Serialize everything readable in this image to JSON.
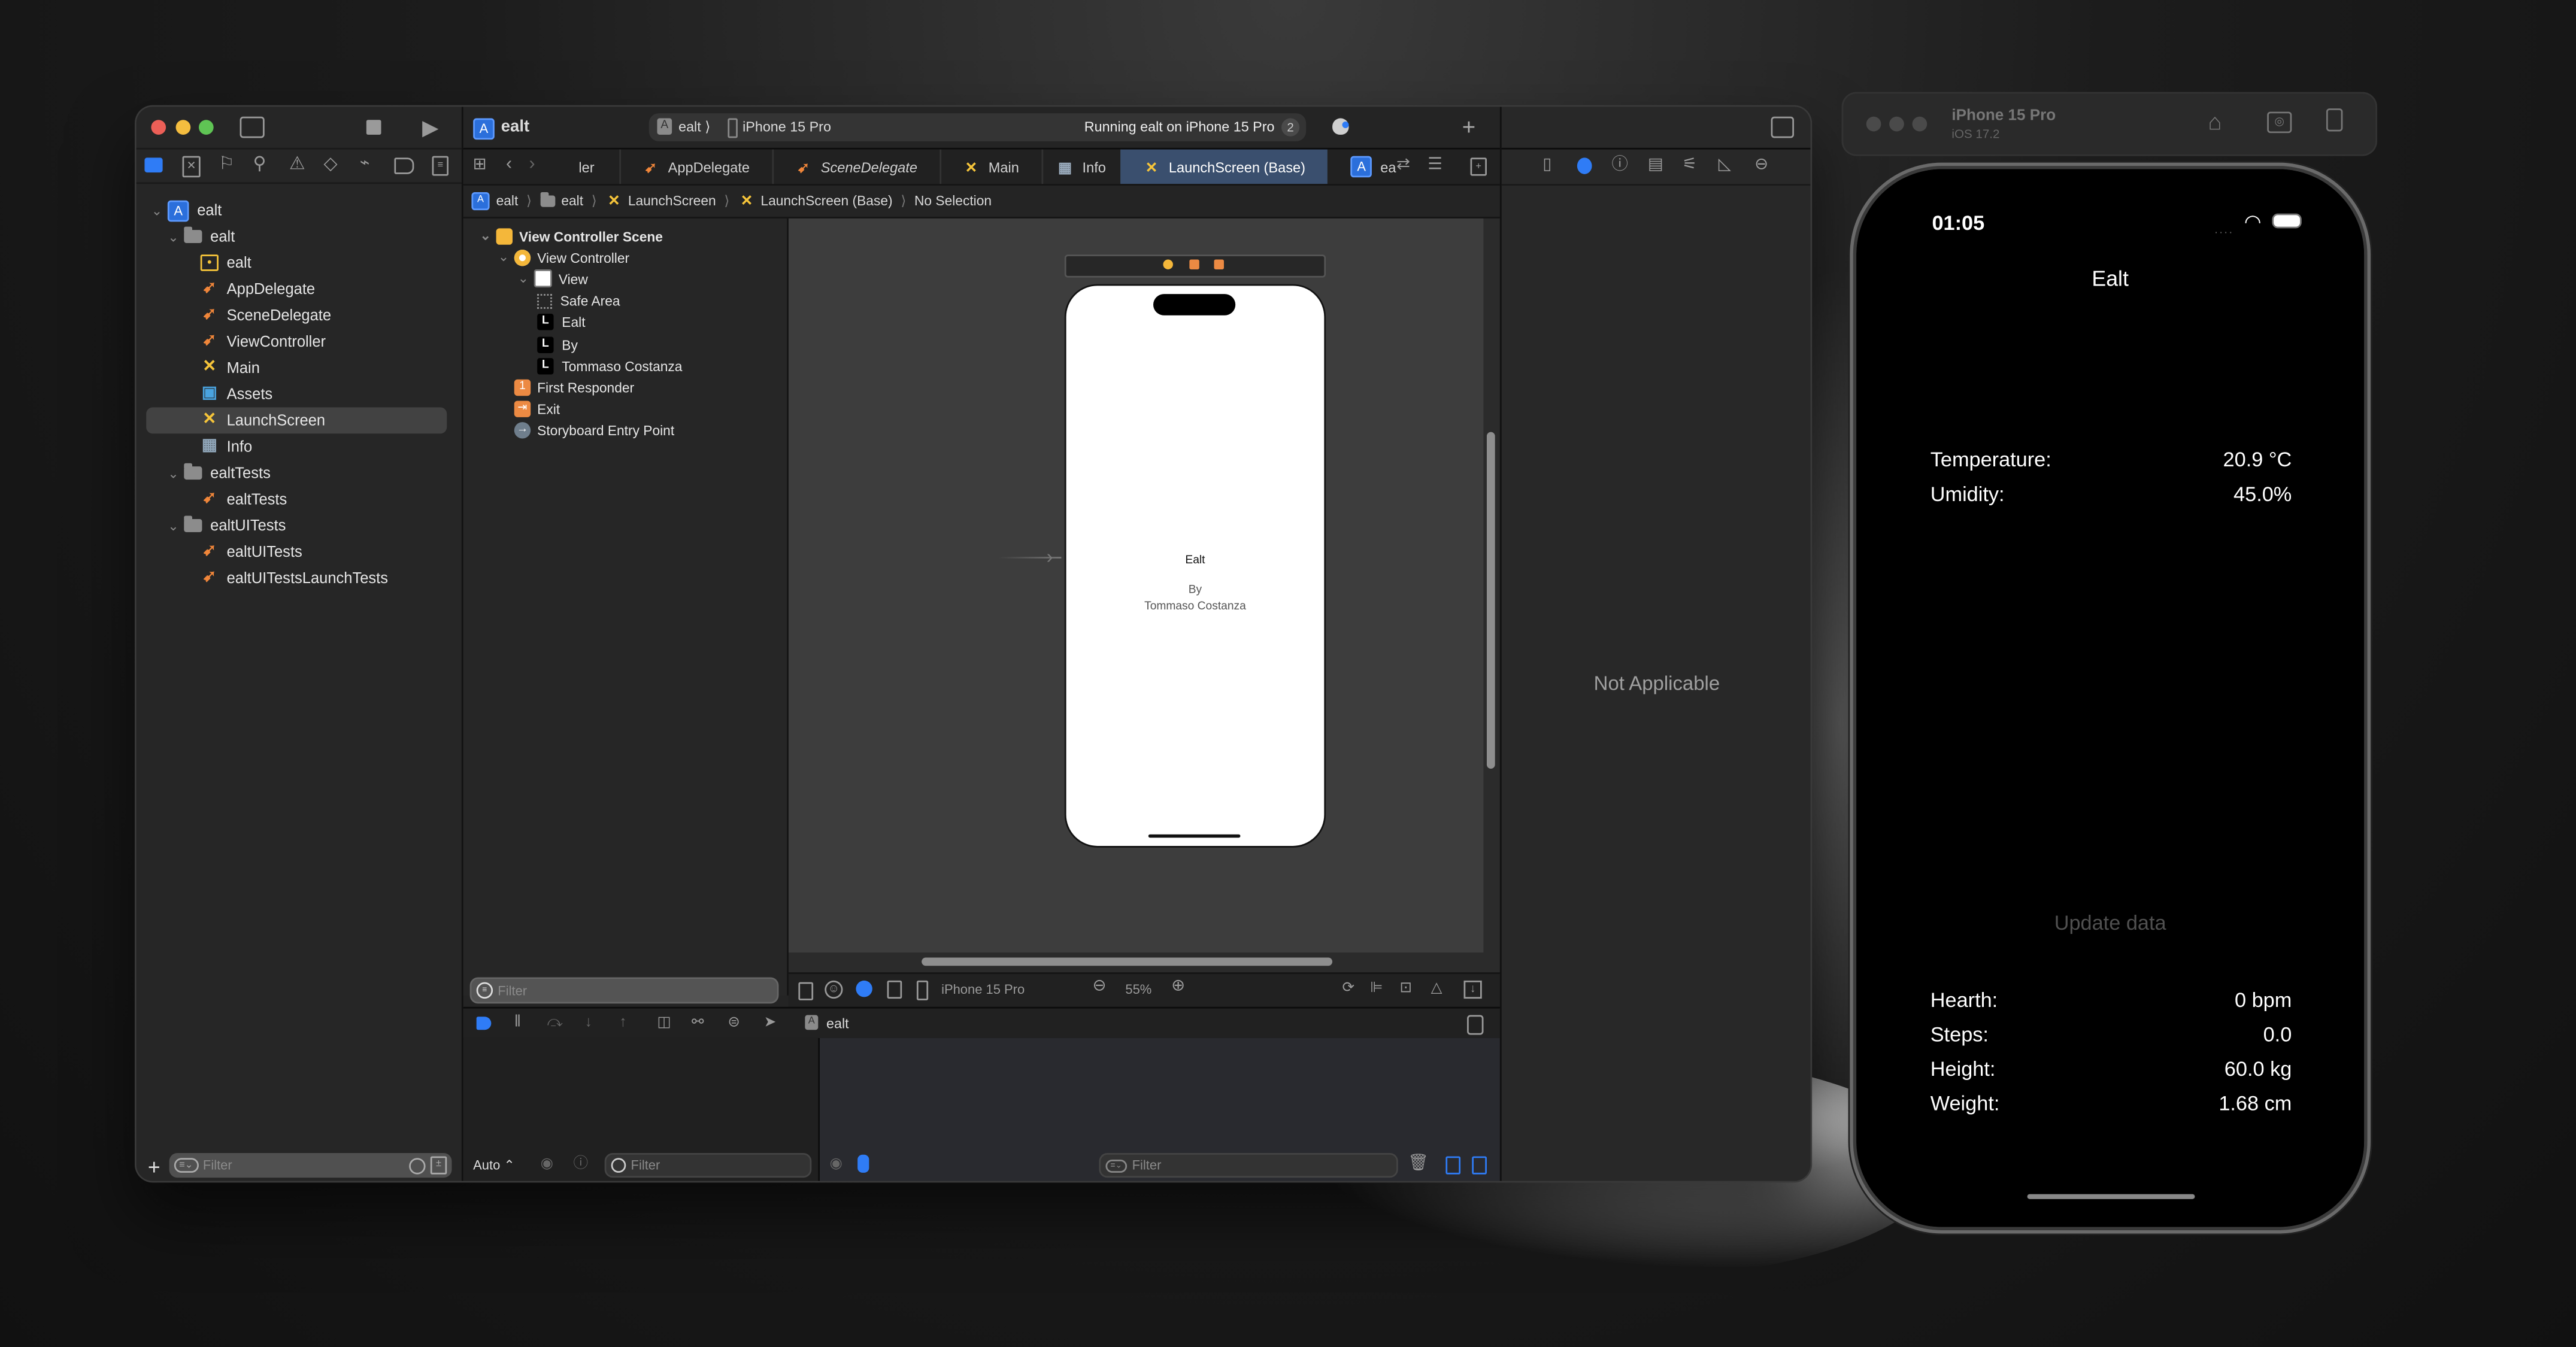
{
  "xcode": {
    "project_name": "ealt",
    "scheme": {
      "target": "ealt",
      "device": "iPhone 15 Pro"
    },
    "status": {
      "text": "Running ealt on iPhone 15 Pro",
      "badge": "2"
    },
    "navigator_tabs": [
      "project-navigator",
      "source-control",
      "bookmarks",
      "find",
      "issues",
      "tests",
      "debug",
      "breakpoints",
      "reports"
    ],
    "file_tree": [
      {
        "label": "ealt",
        "type": "project",
        "level": 0,
        "expanded": true
      },
      {
        "label": "ealt",
        "type": "folder",
        "level": 1,
        "expanded": true
      },
      {
        "label": "ealt",
        "type": "entitlements",
        "level": 2
      },
      {
        "label": "AppDelegate",
        "type": "swift",
        "level": 2
      },
      {
        "label": "SceneDelegate",
        "type": "swift",
        "level": 2
      },
      {
        "label": "ViewController",
        "type": "swift",
        "level": 2
      },
      {
        "label": "Main",
        "type": "storyboard",
        "level": 2
      },
      {
        "label": "Assets",
        "type": "assets",
        "level": 2
      },
      {
        "label": "LaunchScreen",
        "type": "storyboard",
        "level": 2,
        "selected": true
      },
      {
        "label": "Info",
        "type": "plist",
        "level": 2
      },
      {
        "label": "ealtTests",
        "type": "folder",
        "level": 1,
        "expanded": true
      },
      {
        "label": "ealtTests",
        "type": "swift",
        "level": 2
      },
      {
        "label": "ealtUITests",
        "type": "folder",
        "level": 1,
        "expanded": true
      },
      {
        "label": "ealtUITests",
        "type": "swift",
        "level": 2
      },
      {
        "label": "ealtUITestsLaunchTests",
        "type": "swift",
        "level": 2
      }
    ],
    "navigator_filter_placeholder": "Filter",
    "editor_tabs": [
      {
        "label": "ler",
        "type": "swift"
      },
      {
        "label": "AppDelegate",
        "type": "swift"
      },
      {
        "label": "SceneDelegate",
        "type": "swift",
        "italic": true
      },
      {
        "label": "Main",
        "type": "storyboard"
      },
      {
        "label": "Info",
        "type": "plist"
      },
      {
        "label": "LaunchScreen (Base)",
        "type": "storyboard",
        "active": true
      },
      {
        "label": "ea",
        "type": "project"
      }
    ],
    "breadcrumb": [
      "ealt",
      "ealt",
      "LaunchScreen",
      "LaunchScreen (Base)",
      "No Selection"
    ],
    "outline": [
      {
        "label": "View Controller Scene",
        "icon": "scene",
        "level": 0,
        "bold": true
      },
      {
        "label": "View Controller",
        "icon": "view-controller",
        "level": 1
      },
      {
        "label": "View",
        "icon": "view",
        "level": 2
      },
      {
        "label": "Safe Area",
        "icon": "safe-area",
        "level": 3
      },
      {
        "label": "Ealt",
        "icon": "label",
        "level": 3
      },
      {
        "label": "By",
        "icon": "label",
        "level": 3
      },
      {
        "label": "Tommaso Costanza",
        "icon": "label",
        "level": 3
      },
      {
        "label": "First Responder",
        "icon": "first-responder",
        "level": 1
      },
      {
        "label": "Exit",
        "icon": "exit",
        "level": 1
      },
      {
        "label": "Storyboard Entry Point",
        "icon": "entry-point",
        "level": 1
      }
    ],
    "outline_filter_placeholder": "Filter",
    "canvas_preview": {
      "title": "Ealt",
      "by": "By",
      "author": "Tommaso Costanza"
    },
    "canvas_bar": {
      "device": "iPhone 15 Pro",
      "zoom": "55%"
    },
    "debug_bar": {
      "target": "ealt"
    },
    "debug_footer": {
      "auto_label": "Auto ⌃",
      "filter_placeholder": "Filter",
      "console_filter_placeholder": "Filter"
    },
    "inspector": {
      "empty_text": "Not Applicable"
    }
  },
  "simulator": {
    "device": "iPhone 15 Pro",
    "os": "iOS 17.2",
    "status_time": "01:05",
    "app": {
      "title": "Ealt",
      "environment": [
        {
          "label": "Temperature:",
          "value": "20.9 °C"
        },
        {
          "label": "Umidity:",
          "value": "45.0%"
        }
      ],
      "update_button": "Update data",
      "health": [
        {
          "label": "Hearth:",
          "value": "0 bpm"
        },
        {
          "label": "Steps:",
          "value": "0.0"
        },
        {
          "label": "Height:",
          "value": "60.0 kg"
        },
        {
          "label": "Weight:",
          "value": "1.68 cm"
        }
      ]
    }
  },
  "colors": {
    "accent": "#2f7cf6",
    "swift": "#f0863a",
    "storyboard": "#f5c43a",
    "selected_tab": "#3a4f6e"
  }
}
